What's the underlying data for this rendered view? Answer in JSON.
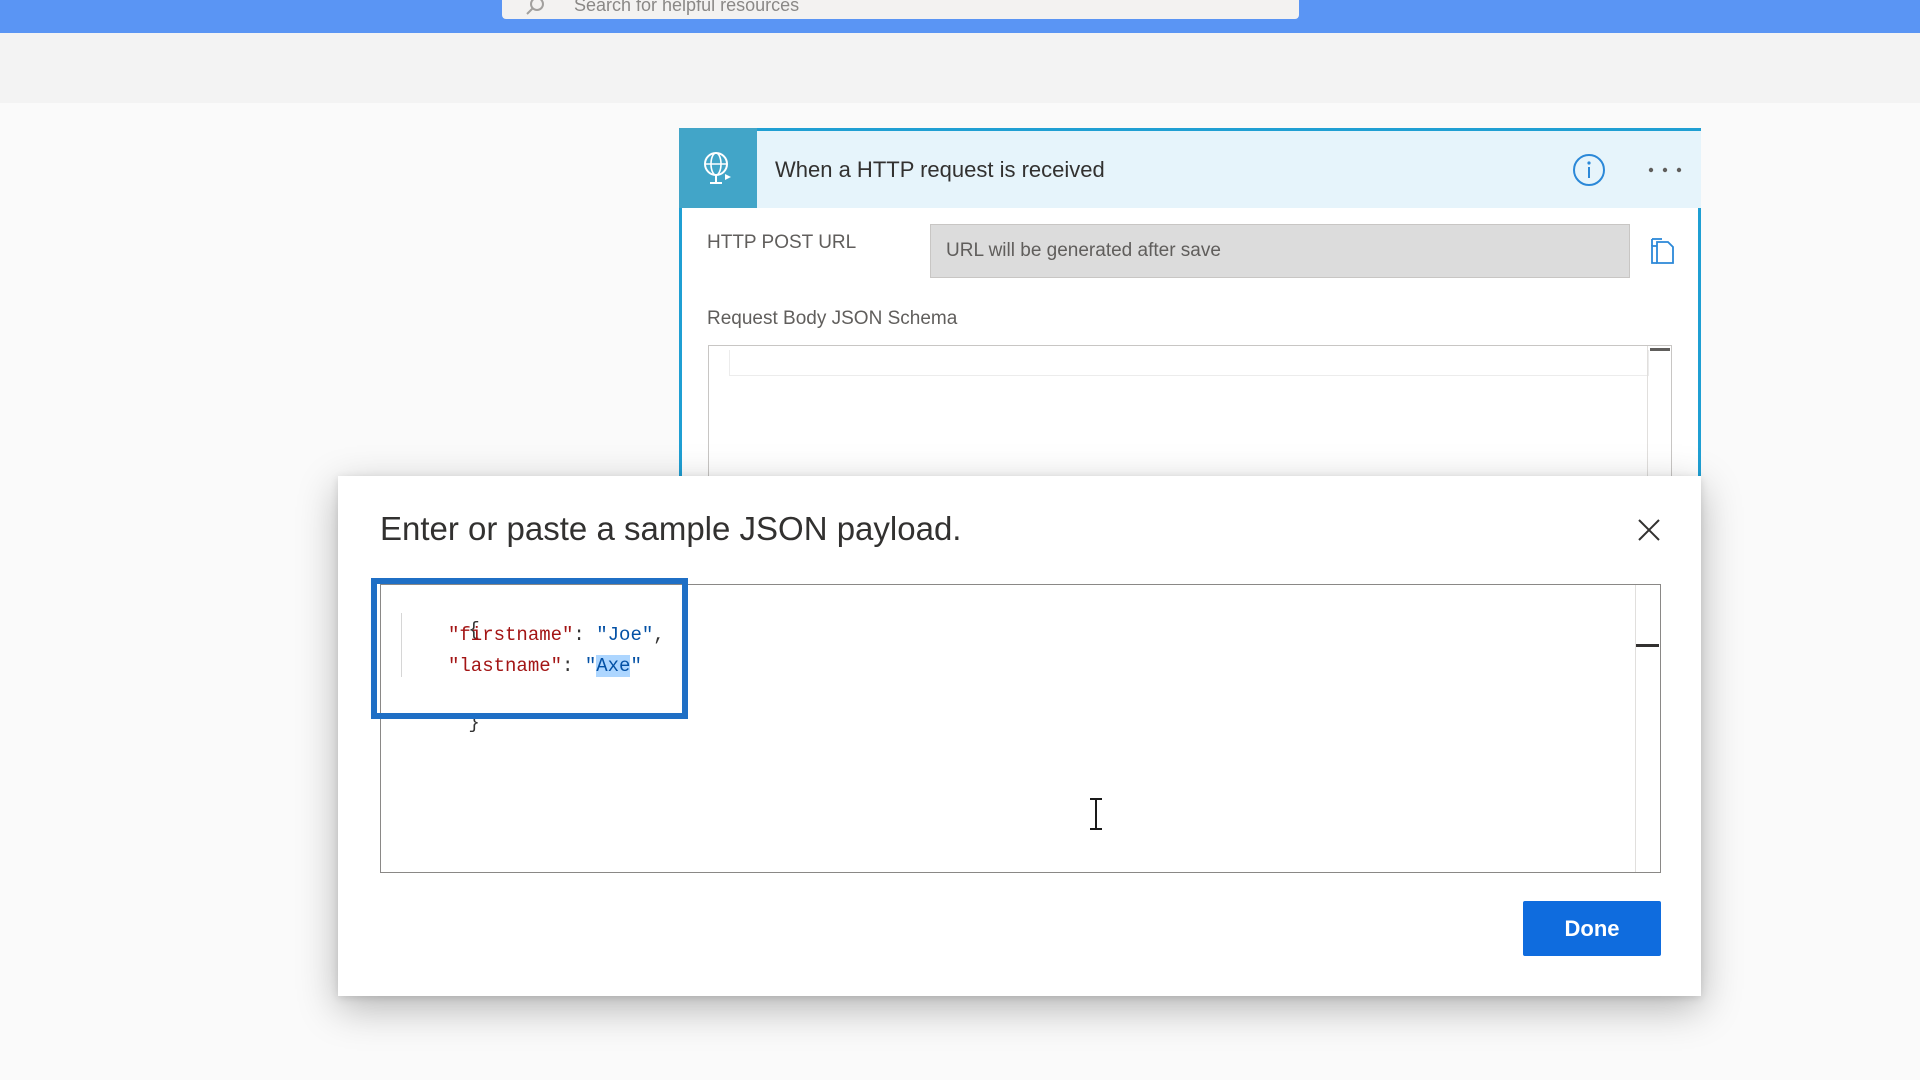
{
  "header": {
    "search_placeholder": "Search for helpful resources"
  },
  "trigger_card": {
    "title": "When a HTTP request is received",
    "http_post_url_label": "HTTP POST URL",
    "http_post_url_value": "URL will be generated after save",
    "schema_label": "Request Body JSON Schema"
  },
  "modal": {
    "title": "Enter or paste a sample JSON payload.",
    "json_lines": {
      "open_brace": "{",
      "firstname_key": "\"firstname\"",
      "firstname_value": "\"Joe\"",
      "lastname_key": "\"lastname\"",
      "lastname_value_quote_open": "\"",
      "lastname_value_selected": "Axe",
      "lastname_value_quote_close": "\"",
      "close_brace": "}"
    },
    "done_label": "Done"
  },
  "colors": {
    "topbar": "#5a95f4",
    "accent": "#1f9fd3",
    "highlight_box": "#1f6fc5",
    "done_button": "#0f6cde"
  }
}
